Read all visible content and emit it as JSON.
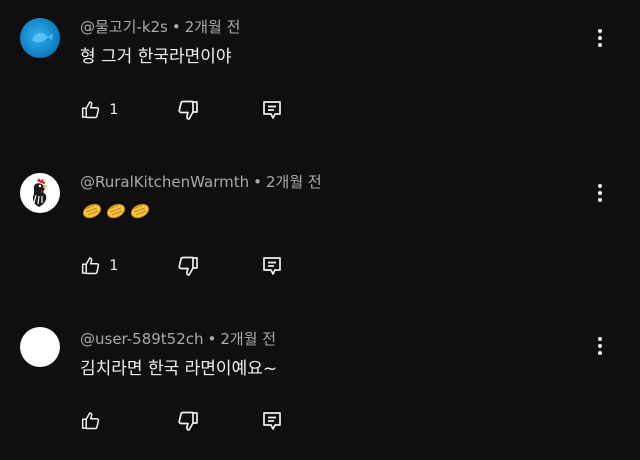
{
  "comments": [
    {
      "author": "@물고기-k2s",
      "separator": "•",
      "time": "2개월 전",
      "text": "형 그거 한국라면이야",
      "likes": "1",
      "avatar_icon": "fish-avatar"
    },
    {
      "author": "@RuralKitchenWarmth",
      "separator": "•",
      "time": "2개월 전",
      "text": "👏👏👏",
      "likes": "1",
      "avatar_icon": "rooster-avatar"
    },
    {
      "author": "@user-589t52ch",
      "separator": "•",
      "time": "2개월 전",
      "text": "김치라면 한국 라면이예요~",
      "likes": "",
      "avatar_icon": "default-avatar"
    }
  ],
  "icons": {
    "like": "thumbs-up-icon",
    "dislike": "thumbs-down-icon",
    "reply": "reply-icon",
    "menu": "more-vert-icon"
  },
  "colors": {
    "background": "#0f0f0f",
    "text": "#f1f1f1",
    "meta": "#aaaaaa"
  }
}
